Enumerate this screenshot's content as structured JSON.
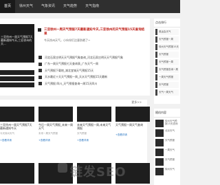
{
  "nav": {
    "items": [
      "首页",
      "徐州天气",
      "气象资讯",
      "天气趋势",
      "天气指南"
    ]
  },
  "feature": {
    "carousel_caption": "三亚徐州一周天气预报7天最新通知今天,三亚徐州的天...",
    "title": "三亚徐州一周天气预报7天最新通知今天,三亚徐州的天气预报15天查询结果",
    "desc": "今天徐州天气，小伙伴们注意防晒了~"
  },
  "news": [
    "河北石家庄明天天气预报气象查询_河北石家庄明天天气预报气象",
    "广东一周天气预报七天查询表_广东天气一周",
    "天气预报下载地_湖北宜城天气预报15天",
    "天水最近十天天气预报一周_天水天气预报15天最新",
    "天气预报 四川_天气预报查询一周15天四川"
  ],
  "sidebar": {
    "header": "点击排行",
    "items": [
      "奥运会天气",
      "天气预报一周",
      "徐州天气预报15天",
      "天气预报",
      "天气预报一周",
      "天气预报查询一周",
      "一周天气预报",
      "天气预报",
      "天气一周天气"
    ]
  },
  "sidebar2": {
    "header": "随机内容",
    "items": [
      "徐州天气预报15天查询",
      "北京天气",
      "天气预报",
      "一周天气",
      "天气预报",
      "徐州天气"
    ]
  },
  "cards": {
    "more": "更多>>",
    "items": [
      {
        "title": "三亚徐州一周天气预报7天最新通知今天",
        "desc": "今天徐州天气",
        "btn": "+查看详请"
      },
      {
        "title": "今后一周天气预报_未来一周天气",
        "desc": "未来一周天气预报",
        "btn": "+查看详请"
      },
      {
        "title": "未来天气预报一周,未来天气预报",
        "desc": "天气预报",
        "btn": "+查看详请"
      },
      {
        "title": "天气预报一周天气查询",
        "desc": "",
        "btn": "+查看详请"
      }
    ]
  },
  "watermark": "链发SEO"
}
